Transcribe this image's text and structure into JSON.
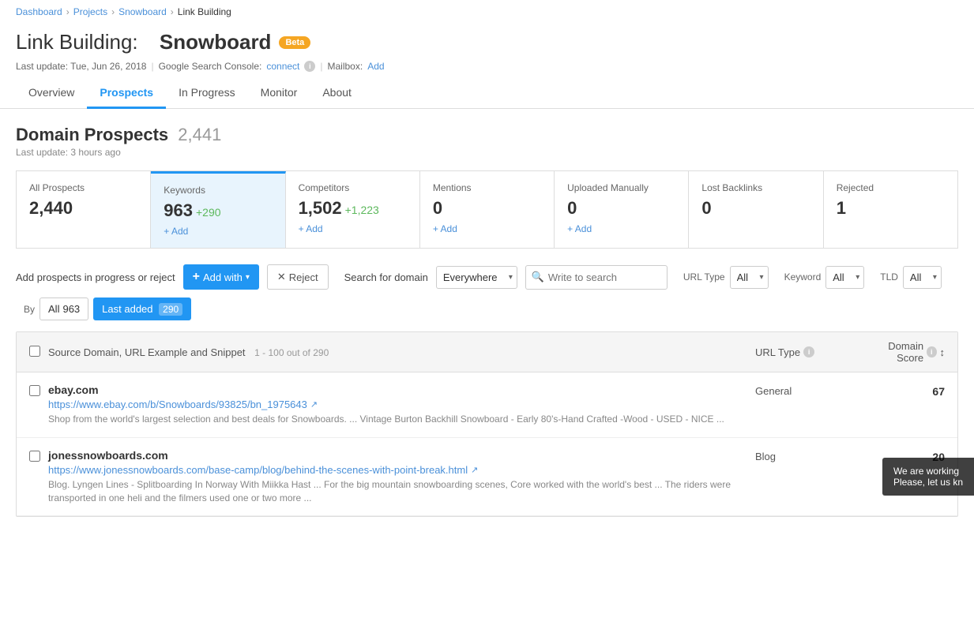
{
  "breadcrumb": {
    "items": [
      "Dashboard",
      "Projects",
      "Snowboard",
      "Link Building"
    ]
  },
  "header": {
    "title_prefix": "Link Building:",
    "title_project": "Snowboard",
    "beta_label": "Beta",
    "last_update_label": "Last update: Tue, Jun 26, 2018",
    "google_console_label": "Google Search Console:",
    "google_console_link": "connect",
    "mailbox_label": "Mailbox:",
    "mailbox_link": "Add"
  },
  "tabs": [
    {
      "id": "overview",
      "label": "Overview",
      "active": false
    },
    {
      "id": "prospects",
      "label": "Prospects",
      "active": true
    },
    {
      "id": "in-progress",
      "label": "In Progress",
      "active": false
    },
    {
      "id": "monitor",
      "label": "Monitor",
      "active": false
    },
    {
      "id": "about",
      "label": "About",
      "active": false
    }
  ],
  "domain_prospects": {
    "title": "Domain Prospects",
    "count": "2,441",
    "last_update": "Last update: 3 hours ago"
  },
  "cards": [
    {
      "id": "all-prospects",
      "label": "All Prospects",
      "value": "2,440",
      "delta": "",
      "add": false,
      "active": false
    },
    {
      "id": "keywords",
      "label": "Keywords",
      "value": "963",
      "delta": "+290",
      "add": true,
      "add_label": "+ Add",
      "active": true
    },
    {
      "id": "competitors",
      "label": "Competitors",
      "value": "1,502",
      "delta": "+1,223",
      "add": true,
      "add_label": "+ Add",
      "active": false
    },
    {
      "id": "mentions",
      "label": "Mentions",
      "value": "0",
      "delta": "",
      "add": true,
      "add_label": "+ Add",
      "active": false
    },
    {
      "id": "uploaded-manually",
      "label": "Uploaded Manually",
      "value": "0",
      "delta": "",
      "add": true,
      "add_label": "+ Add",
      "active": false
    },
    {
      "id": "lost-backlinks",
      "label": "Lost Backlinks",
      "value": "0",
      "delta": "",
      "add": false,
      "active": false
    },
    {
      "id": "rejected",
      "label": "Rejected",
      "value": "1",
      "delta": "",
      "add": false,
      "active": false
    }
  ],
  "filters": {
    "label": "Add prospects in progress or reject",
    "add_label": "Add with",
    "reject_label": "Reject",
    "search_for_domain_label": "Search for domain",
    "search_placeholder": "Write to search",
    "dropdown_default": "Everywhere",
    "url_type_label": "URL Type",
    "url_type_value": "All",
    "keyword_label": "Keyword",
    "keyword_value": "All",
    "tld_label": "TLD",
    "tld_value": "All",
    "by_label": "By",
    "last_added_label": "Last added",
    "all_label": "All",
    "all_count": "963",
    "last_added_count": "290"
  },
  "table": {
    "header": {
      "col_main": "Source Domain, URL Example and Snippet",
      "col_count": "1 - 100 out of 290",
      "col_urltype": "URL Type",
      "col_score": "Domain Score"
    },
    "rows": [
      {
        "domain": "ebay.com",
        "url": "https://www.ebay.com/b/Snowboards/93825/bn_1975643",
        "snippet": "Shop from the world's largest selection and best deals for Snowboards. ... Vintage Burton Backhill Snowboard - Early 80's-Hand Crafted -Wood - USED - NICE ...",
        "url_type": "General",
        "score": "67"
      },
      {
        "domain": "jonessnowboards.com",
        "url": "https://www.jonessnowboards.com/base-camp/blog/behind-the-scenes-with-point-break.html",
        "snippet": "Blog. Lyngen Lines - Splitboarding In Norway With Miikka Hast ... For the big mountain snowboarding scenes, Core worked with the world's best ... The riders were transported in one heli and the filmers used one or two more ...",
        "url_type": "Blog",
        "score": "20"
      }
    ]
  },
  "notification": {
    "line1": "We are working",
    "line2": "Please, let us kn"
  }
}
